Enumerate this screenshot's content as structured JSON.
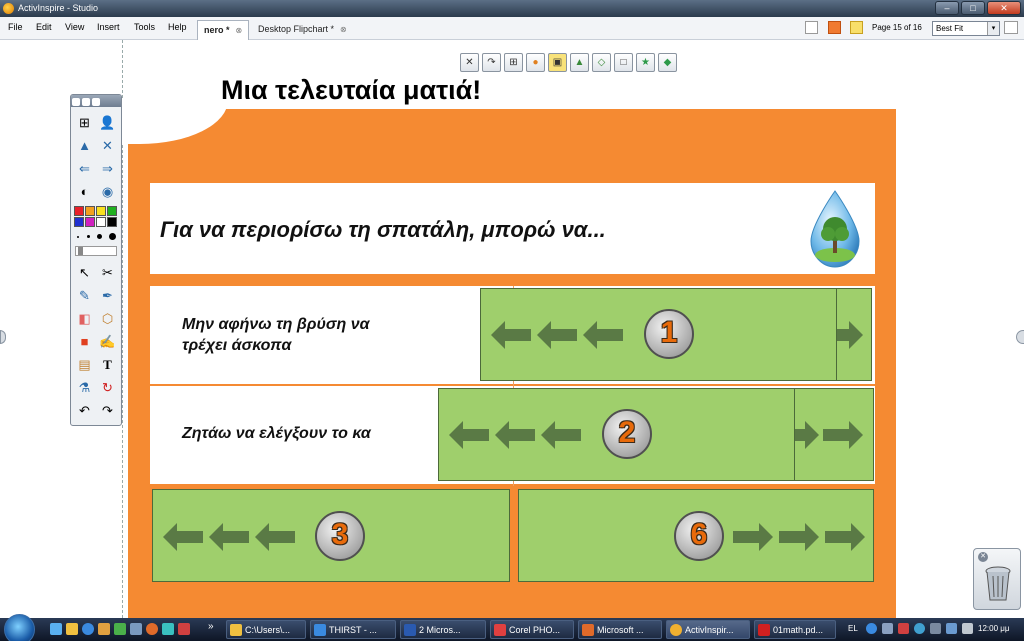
{
  "window": {
    "title": "ActivInspire - Studio",
    "minimize_glyph": "–",
    "maximize_glyph": "□",
    "close_glyph": "✕"
  },
  "menu": {
    "file": "File",
    "edit": "Edit",
    "view": "View",
    "insert": "Insert",
    "tools": "Tools",
    "help": "Help"
  },
  "tabs": [
    {
      "label": "nero *",
      "close": "⊗"
    },
    {
      "label": "Desktop Flipchart *",
      "close": "⊗"
    }
  ],
  "page_indicator": "Page 15 of 16",
  "zoom": {
    "value": "Best Fit",
    "arrow": "▾"
  },
  "page": {
    "title": "Μια τελευταία ματιά!",
    "question": "Για να περιορίσω τη σπατάλη, μπορώ να...",
    "rows": [
      {
        "text_line1": "Μην αφήνω τη βρύση να",
        "text_line2": "τρέχει άσκοπα"
      },
      {
        "text_line1": "Ζητάω να ελέγξουν το κα",
        "text_line2": ""
      }
    ],
    "badges": [
      "1",
      "2",
      "3",
      "6"
    ]
  },
  "page_toolbar": [
    "✕",
    "↷",
    "⊞",
    "●",
    "▣",
    "▲",
    "◇",
    "□",
    "★",
    "◆"
  ],
  "palette_tools": [
    "⊞",
    "👤",
    "▲",
    "✕",
    "⇐",
    "⇒",
    "◐",
    "◉",
    "↖",
    "✂",
    "✎",
    "✒",
    "◧",
    "⬡",
    "■",
    "✍",
    "▤",
    "T",
    "⚗",
    "↻",
    "↶",
    "↷"
  ],
  "taskbar": {
    "tasks": [
      "C:\\Users\\...",
      "THIRST - ...",
      "2 Micros...",
      "Corel PHO...",
      "Microsoft ...",
      "ActivInspir...",
      "01math.pd..."
    ],
    "overflow": "»",
    "lang": "EL",
    "clock": "12:00 μμ"
  },
  "colors": {
    "orange": "#f58a32",
    "green_panel": "#9fcf6c",
    "arrow": "#5a7a45",
    "badge_text": "#e86a0a"
  }
}
